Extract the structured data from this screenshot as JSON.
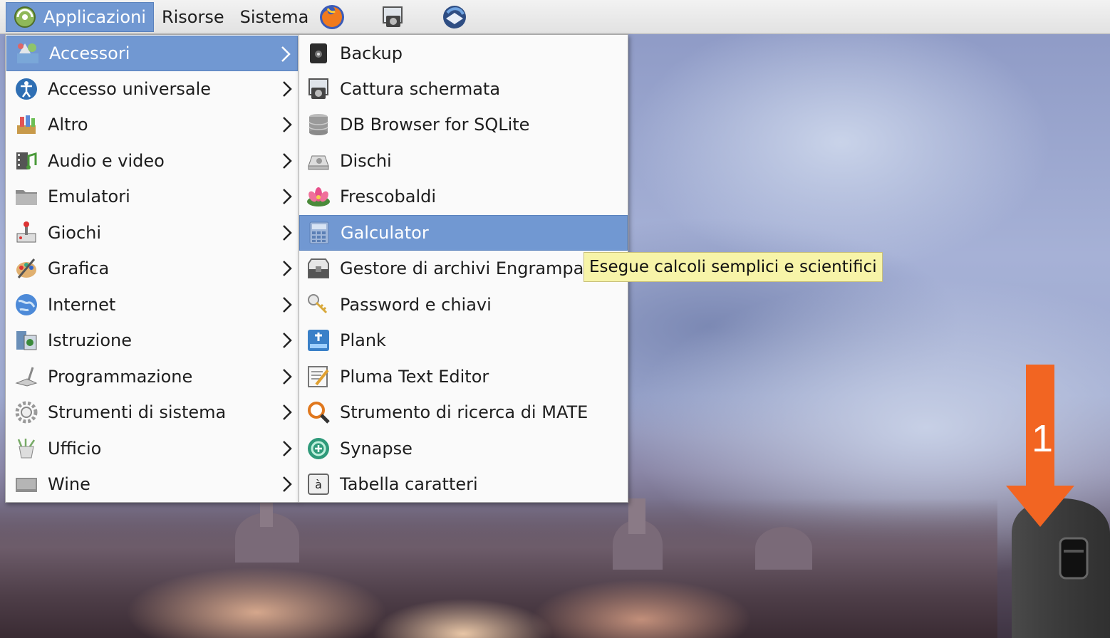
{
  "panel": {
    "applications": "Applicazioni",
    "places": "Risorse",
    "system": "Sistema",
    "launchers": [
      "firefox-icon",
      "screenshot-icon",
      "thunderbird-icon"
    ]
  },
  "main_menu": {
    "selected": "Accessori",
    "items": [
      {
        "label": "Accessori",
        "icon": "accessories-icon"
      },
      {
        "label": "Accesso universale",
        "icon": "universal-access-icon"
      },
      {
        "label": "Altro",
        "icon": "other-icon"
      },
      {
        "label": "Audio e video",
        "icon": "multimedia-icon"
      },
      {
        "label": "Emulatori",
        "icon": "folder-icon"
      },
      {
        "label": "Giochi",
        "icon": "games-icon"
      },
      {
        "label": "Grafica",
        "icon": "graphics-icon"
      },
      {
        "label": "Internet",
        "icon": "internet-icon"
      },
      {
        "label": "Istruzione",
        "icon": "education-icon"
      },
      {
        "label": "Programmazione",
        "icon": "programming-icon"
      },
      {
        "label": "Strumenti di sistema",
        "icon": "system-tools-icon"
      },
      {
        "label": "Ufficio",
        "icon": "office-icon"
      },
      {
        "label": "Wine",
        "icon": "wine-icon"
      }
    ]
  },
  "sub_menu": {
    "selected": "Galculator",
    "items": [
      {
        "label": "Backup",
        "icon": "backup-icon"
      },
      {
        "label": "Cattura schermata",
        "icon": "screenshot-icon"
      },
      {
        "label": "DB Browser for SQLite",
        "icon": "database-icon"
      },
      {
        "label": "Dischi",
        "icon": "disks-icon"
      },
      {
        "label": "Frescobaldi",
        "icon": "frescobaldi-icon"
      },
      {
        "label": "Galculator",
        "icon": "calculator-icon"
      },
      {
        "label": "Gestore di archivi Engrampa",
        "icon": "archive-manager-icon"
      },
      {
        "label": "Password e chiavi",
        "icon": "keys-icon"
      },
      {
        "label": "Plank",
        "icon": "plank-icon"
      },
      {
        "label": "Pluma Text Editor",
        "icon": "text-editor-icon"
      },
      {
        "label": "Strumento di ricerca di MATE",
        "icon": "search-icon"
      },
      {
        "label": "Synapse",
        "icon": "synapse-icon"
      },
      {
        "label": "Tabella caratteri",
        "icon": "character-map-icon"
      }
    ]
  },
  "tooltip": "Esegue calcoli semplici e scientifici",
  "annotation": {
    "step": "1",
    "arrow_color": "#f26522"
  },
  "colors": {
    "selection": "#7198d2",
    "tooltip_bg": "#f7f4a8",
    "menu_bg": "#fafafa"
  }
}
